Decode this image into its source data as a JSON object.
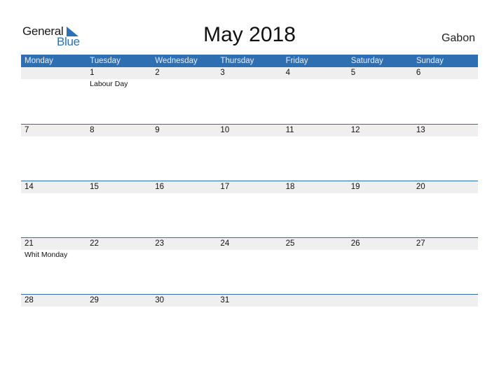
{
  "logo": {
    "word1": "General",
    "word2": "Blue"
  },
  "title": "May 2018",
  "country": "Gabon",
  "colors": {
    "accent": "#2e6fb2",
    "row_bg": "#efefef",
    "logo_blue": "#2a72b8"
  },
  "weekdays": [
    "Monday",
    "Tuesday",
    "Wednesday",
    "Thursday",
    "Friday",
    "Saturday",
    "Sunday"
  ],
  "weeks": [
    {
      "days": [
        "",
        "1",
        "2",
        "3",
        "4",
        "5",
        "6"
      ],
      "events": [
        "",
        "Labour Day",
        "",
        "",
        "",
        "",
        ""
      ]
    },
    {
      "days": [
        "7",
        "8",
        "9",
        "10",
        "11",
        "12",
        "13"
      ],
      "events": [
        "",
        "",
        "",
        "",
        "",
        "",
        ""
      ]
    },
    {
      "days": [
        "14",
        "15",
        "16",
        "17",
        "18",
        "19",
        "20"
      ],
      "events": [
        "",
        "",
        "",
        "",
        "",
        "",
        ""
      ]
    },
    {
      "days": [
        "21",
        "22",
        "23",
        "24",
        "25",
        "26",
        "27"
      ],
      "events": [
        "Whit Monday",
        "",
        "",
        "",
        "",
        "",
        ""
      ]
    },
    {
      "days": [
        "28",
        "29",
        "30",
        "31",
        "",
        "",
        ""
      ],
      "events": [
        "",
        "",
        "",
        "",
        "",
        "",
        ""
      ]
    }
  ]
}
